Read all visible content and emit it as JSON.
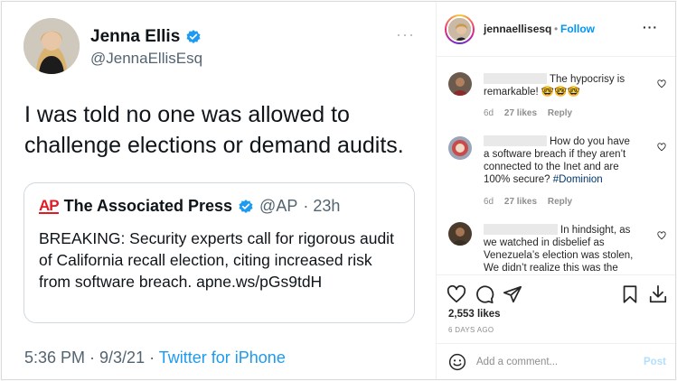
{
  "tweet": {
    "author_name": "Jenna Ellis",
    "author_handle": "@JennaEllisEsq",
    "more_icon": "more-dots-icon",
    "text": "I was told no one was allowed to challenge elections or demand audits.",
    "quoted": {
      "logo_text": "AP",
      "name": "The Associated Press",
      "handle": "@AP",
      "time": "· 23h",
      "body": "BREAKING: Security experts call for rigorous audit of California recall election, citing increased risk from software breach. apne.ws/pGs9tdH"
    },
    "meta": {
      "timestamp": "5:36 PM · 9/3/21 ·",
      "source": "Twitter for iPhone"
    },
    "colors": {
      "verified": "#1d9bf0",
      "ap_red": "#e21a23"
    }
  },
  "header": {
    "username": "jennaellisesq",
    "separator": "•",
    "follow_label": "Follow",
    "more_label": "···"
  },
  "comments": [
    {
      "text": "The hypocrisy is remarkable! 🤓🤓🤓",
      "age": "6d",
      "likes": "27 likes",
      "reply": "Reply"
    },
    {
      "text": "How do you have a software breach if they aren’t connected to the Inet and are 100% secure? ",
      "hashtag": "#Dominion",
      "age": "6d",
      "likes": "27 likes",
      "reply": "Reply"
    },
    {
      "text": "In hindsight, as we watched in disbelief as Venezuela’s election was stolen, We didn’t realize this was the",
      "age": "",
      "likes": "",
      "reply": ""
    }
  ],
  "actions": {
    "icons": [
      "heart-icon",
      "comment-icon",
      "share-icon",
      "save-icon",
      "download-icon"
    ],
    "likes": "2,553 likes",
    "posted": "6 DAYS AGO"
  },
  "add_comment": {
    "placeholder": "Add a comment...",
    "post_label": "Post"
  },
  "colors": {
    "link_blue": "#0095f6",
    "text": "#262626",
    "muted": "#8e8e8e"
  }
}
